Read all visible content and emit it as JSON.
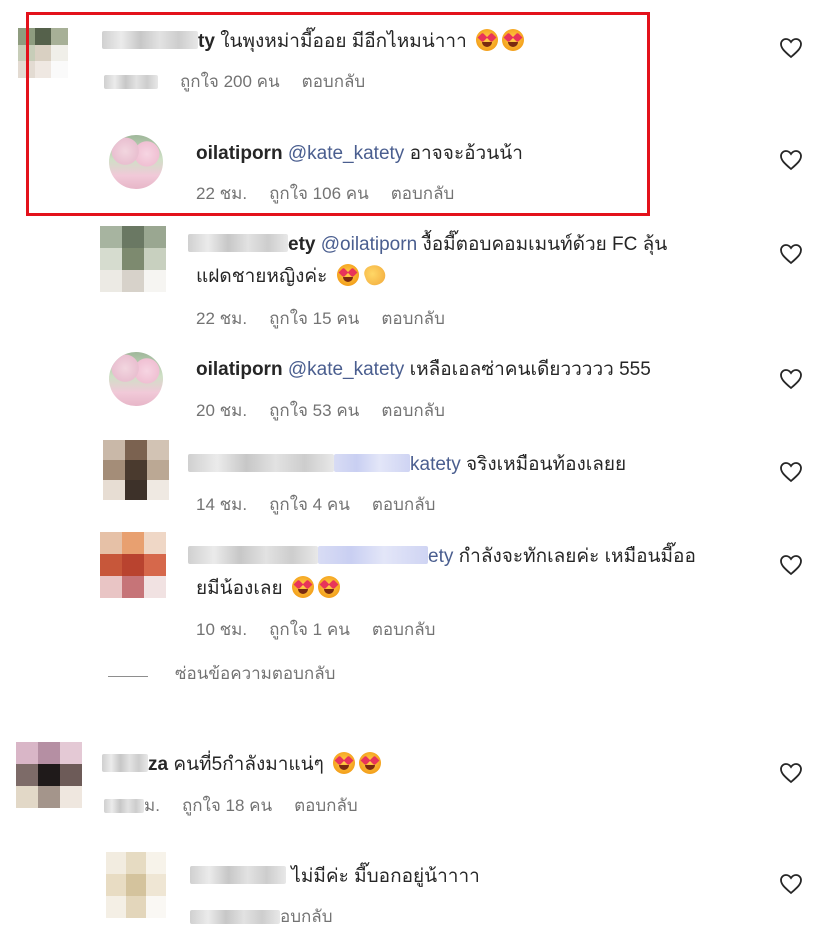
{
  "comments": [
    {
      "id": "c1",
      "user_visible": "ty",
      "text": "ในพุงหม่ามี๊ออย มีอีกไหมน่าาา",
      "time": "22 ชม.",
      "likes": "ถูกใจ 200 คน",
      "reply": "ตอบกลับ"
    },
    {
      "id": "c2",
      "user": "oilatiporn",
      "mention": "@kate_katety",
      "text": "อาจจะอ้วนน้า",
      "time": "22 ชม.",
      "likes": "ถูกใจ 106 คน",
      "reply": "ตอบกลับ"
    },
    {
      "id": "c3",
      "user_visible": "ety",
      "mention": "@oilatiporn",
      "text": "งื้อมี๊ตอบคอมเมนท์ด้วย FC ลุ้น",
      "text2": "แฝดชายหญิงค่ะ",
      "time": "22 ชม.",
      "likes": "ถูกใจ 15 คน",
      "reply": "ตอบกลับ"
    },
    {
      "id": "c4",
      "user": "oilatiporn",
      "mention": "@kate_katety",
      "text": "เหลือเอลซ่าคนเดียววววว 555",
      "time": "20 ชม.",
      "likes": "ถูกใจ 53 คน",
      "reply": "ตอบกลับ"
    },
    {
      "id": "c5",
      "mention_visible": "katety",
      "text": "จริงเหมือนท้องเลยย",
      "time": "14 ชม.",
      "likes": "ถูกใจ 4 คน",
      "reply": "ตอบกลับ"
    },
    {
      "id": "c6",
      "mention_visible": "ety",
      "text": "กำลังจะทักเลยค่ะ เหมือนมี๊ออ",
      "text2": "ยมีน้องเลย",
      "time": "10 ชม.",
      "likes": "ถูกใจ 1 คน",
      "reply": "ตอบกลับ"
    },
    {
      "id": "c7",
      "user_visible": "za",
      "text": "คนที่5กำลังมาแน่ๆ",
      "time_visible": "ม.",
      "likes": "ถูกใจ 18 คน",
      "reply": "ตอบกลับ"
    },
    {
      "id": "c8",
      "text": "ไม่มีค่ะ มี๊บอกอยู่น้าาาา",
      "reply_visible": "อบกลับ"
    }
  ],
  "hide_replies": "ซ่อนข้อความตอบกลับ",
  "icons": {
    "heart": "heart-icon",
    "emoji": "heart-eyes-emoji",
    "clap": "clapping-hands-emoji"
  },
  "colors": {
    "highlight": "#e3111b",
    "mention": "#4a5e8f",
    "meta": "#737373"
  }
}
